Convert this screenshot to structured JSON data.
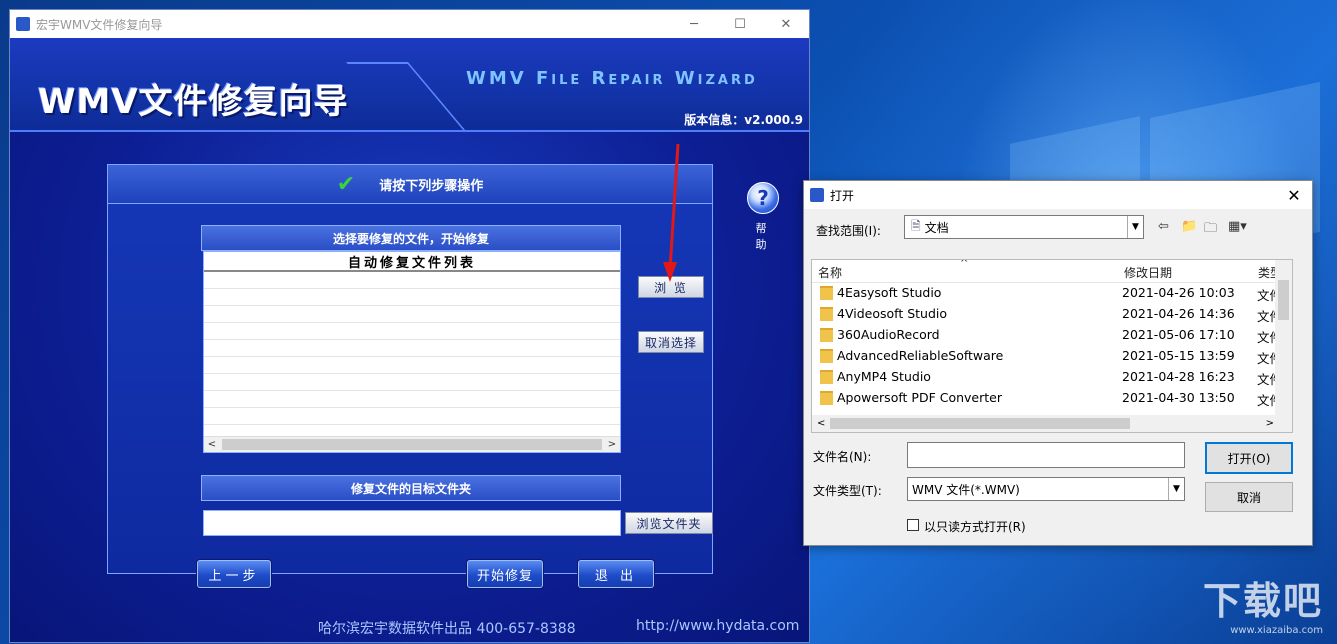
{
  "app": {
    "window_title": "宏宇WMV文件修复向导",
    "banner_cn": "WMV文件修复向导",
    "banner_en": "WMV File Repair Wizard",
    "version": "版本信息：v2.000.9",
    "panel_title": "请按下列步骤操作",
    "select_header": "选择要修复的文件，开始修复",
    "list_header": "自动修复文件列表",
    "browse_button": "浏 览",
    "cancel_select_button": "取消选择",
    "target_header": "修复文件的目标文件夹",
    "target_path": "",
    "browse_folder_button": "浏览文件夹",
    "prev_button": "上一步",
    "start_button": "开始修复",
    "exit_button": "退 出",
    "help_label": "帮 助",
    "footer_company": "哈尔滨宏宇数据软件出品  400-657-8388",
    "footer_url": "http://www.hydata.com"
  },
  "dialog": {
    "title": "打开",
    "lookin_label": "查找范围(I):",
    "lookin_value": "文档",
    "columns": {
      "name": "名称",
      "date": "修改日期",
      "type": "类型"
    },
    "files": [
      {
        "name": "4Easysoft Studio",
        "date": "2021-04-26 10:03",
        "type": "文件"
      },
      {
        "name": "4Videosoft Studio",
        "date": "2021-04-26 14:36",
        "type": "文件"
      },
      {
        "name": "360AudioRecord",
        "date": "2021-05-06 17:10",
        "type": "文件"
      },
      {
        "name": "AdvancedReliableSoftware",
        "date": "2021-05-15 13:59",
        "type": "文件"
      },
      {
        "name": "AnyMP4 Studio",
        "date": "2021-04-28 16:23",
        "type": "文件"
      },
      {
        "name": "Apowersoft PDF Converter",
        "date": "2021-04-30 13:50",
        "type": "文件"
      }
    ],
    "filename_label": "文件名(N):",
    "filename_value": "",
    "filetype_label": "文件类型(T):",
    "filetype_value": "WMV 文件(*.WMV)",
    "readonly_label": "以只读方式打开(R)",
    "open_button": "打开(O)",
    "cancel_button": "取消"
  },
  "watermark": {
    "main": "下载吧",
    "sub": "www.xiazaiba.com"
  }
}
